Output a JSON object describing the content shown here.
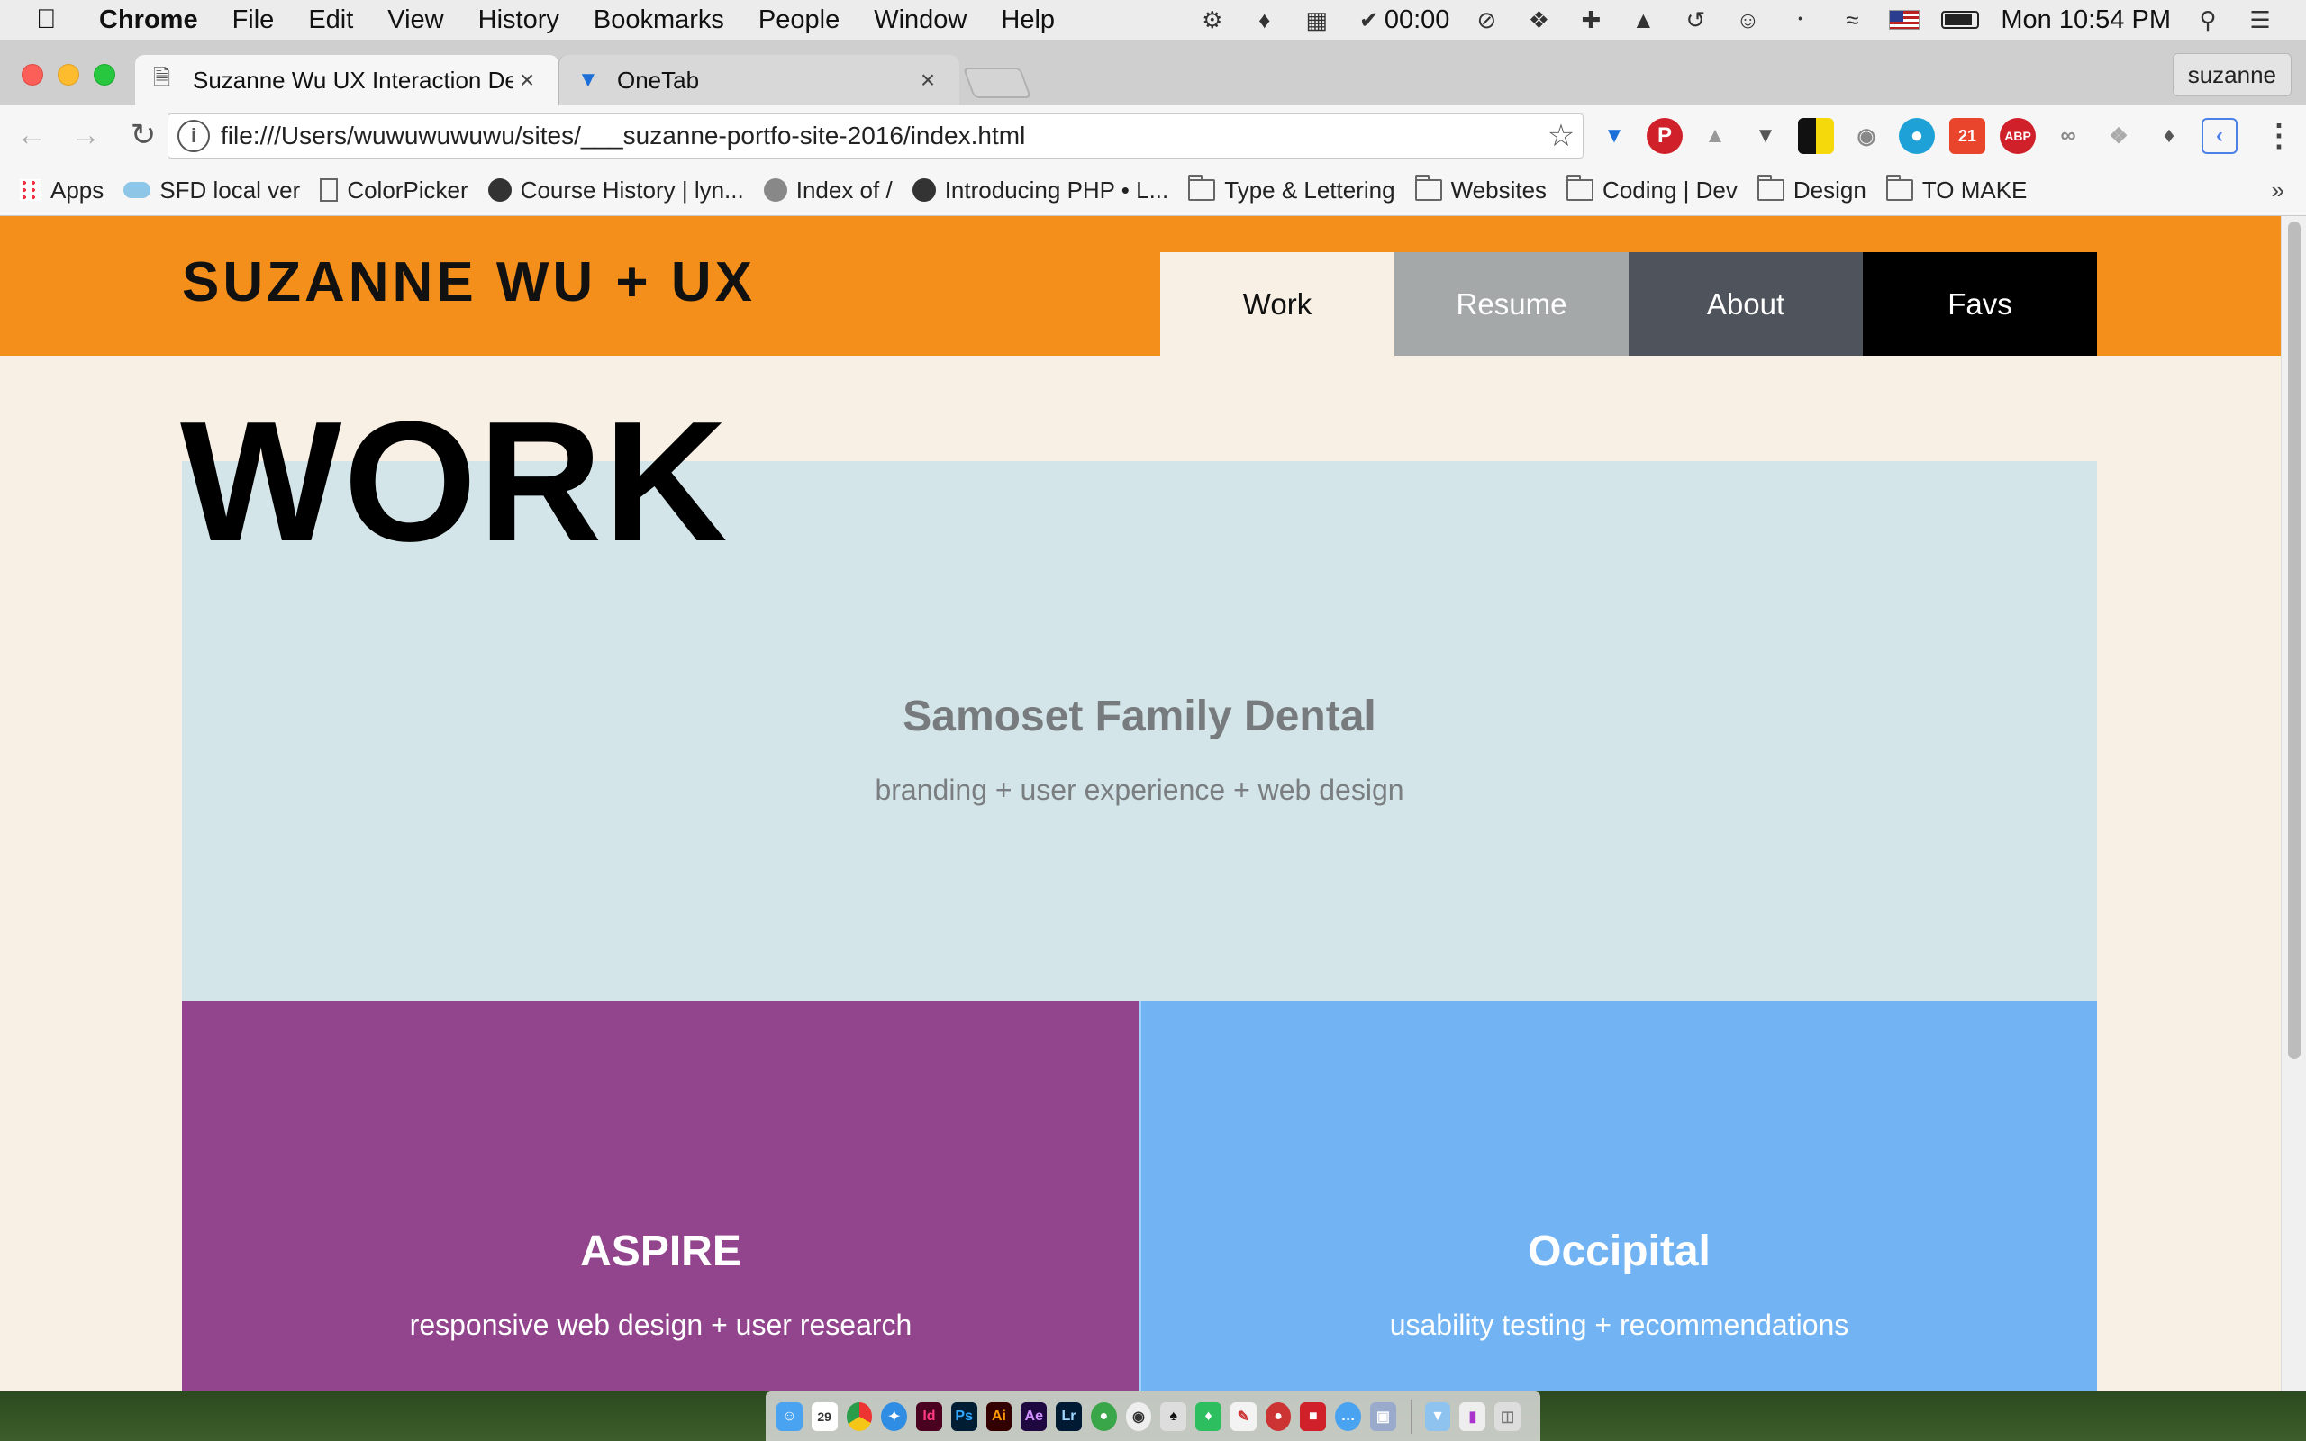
{
  "menubar": {
    "app_name": "Chrome",
    "items": [
      "File",
      "Edit",
      "View",
      "History",
      "Bookmarks",
      "People",
      "Window",
      "Help"
    ],
    "timer": "00:00",
    "clock": "Mon 10:54 PM"
  },
  "browser": {
    "tabs": [
      {
        "title": "Suzanne Wu UX Interaction De"
      },
      {
        "title": "OneTab"
      }
    ],
    "profile_name": "suzanne",
    "url": "file:///Users/wuwuwuwuwu/sites/___suzanne-portfo-site-2016/index.html",
    "extension_badge_count": "21",
    "extension_abp_label": "ABP",
    "bookmarks": [
      {
        "label": "Apps",
        "icon": "apps-grid-icon"
      },
      {
        "label": "SFD local ver",
        "icon": "cloud-icon"
      },
      {
        "label": "ColorPicker",
        "icon": "page-icon"
      },
      {
        "label": "Course History | lyn...",
        "icon": "globe-icon"
      },
      {
        "label": "Index of /",
        "icon": "globe-icon"
      },
      {
        "label": "Introducing PHP • L...",
        "icon": "globe-icon"
      },
      {
        "label": "Type & Lettering",
        "icon": "folder-icon"
      },
      {
        "label": "Websites",
        "icon": "folder-icon"
      },
      {
        "label": "Coding | Dev",
        "icon": "folder-icon"
      },
      {
        "label": "Design",
        "icon": "folder-icon"
      },
      {
        "label": "TO MAKE",
        "icon": "folder-icon"
      }
    ],
    "bookmarks_overflow": "»"
  },
  "site": {
    "logo": "SUZANNE WU + UX",
    "nav": [
      {
        "label": "Work",
        "active": true
      },
      {
        "label": "Resume"
      },
      {
        "label": "About"
      },
      {
        "label": "Favs"
      }
    ],
    "page_title": "WORK",
    "projects": [
      {
        "title": "Samoset Family Dental",
        "subtitle": "branding + user experience + web design",
        "color": "#d3e5e9"
      },
      {
        "title": "ASPIRE",
        "subtitle": "responsive web design + user research",
        "color": "#92448d"
      },
      {
        "title": "Occipital",
        "subtitle": "usability testing + recommendations",
        "color": "#72b4f3"
      }
    ]
  },
  "colors": {
    "header_orange": "#f48f1b",
    "page_background": "#f8f0e4",
    "nav_resume": "#a5a8a8",
    "nav_about": "#4f545c",
    "nav_favs": "#000000"
  },
  "dock": {
    "calendar_day": "29",
    "app_labels": [
      "Id",
      "Ps",
      "Ai",
      "Ae",
      "Lr"
    ]
  }
}
